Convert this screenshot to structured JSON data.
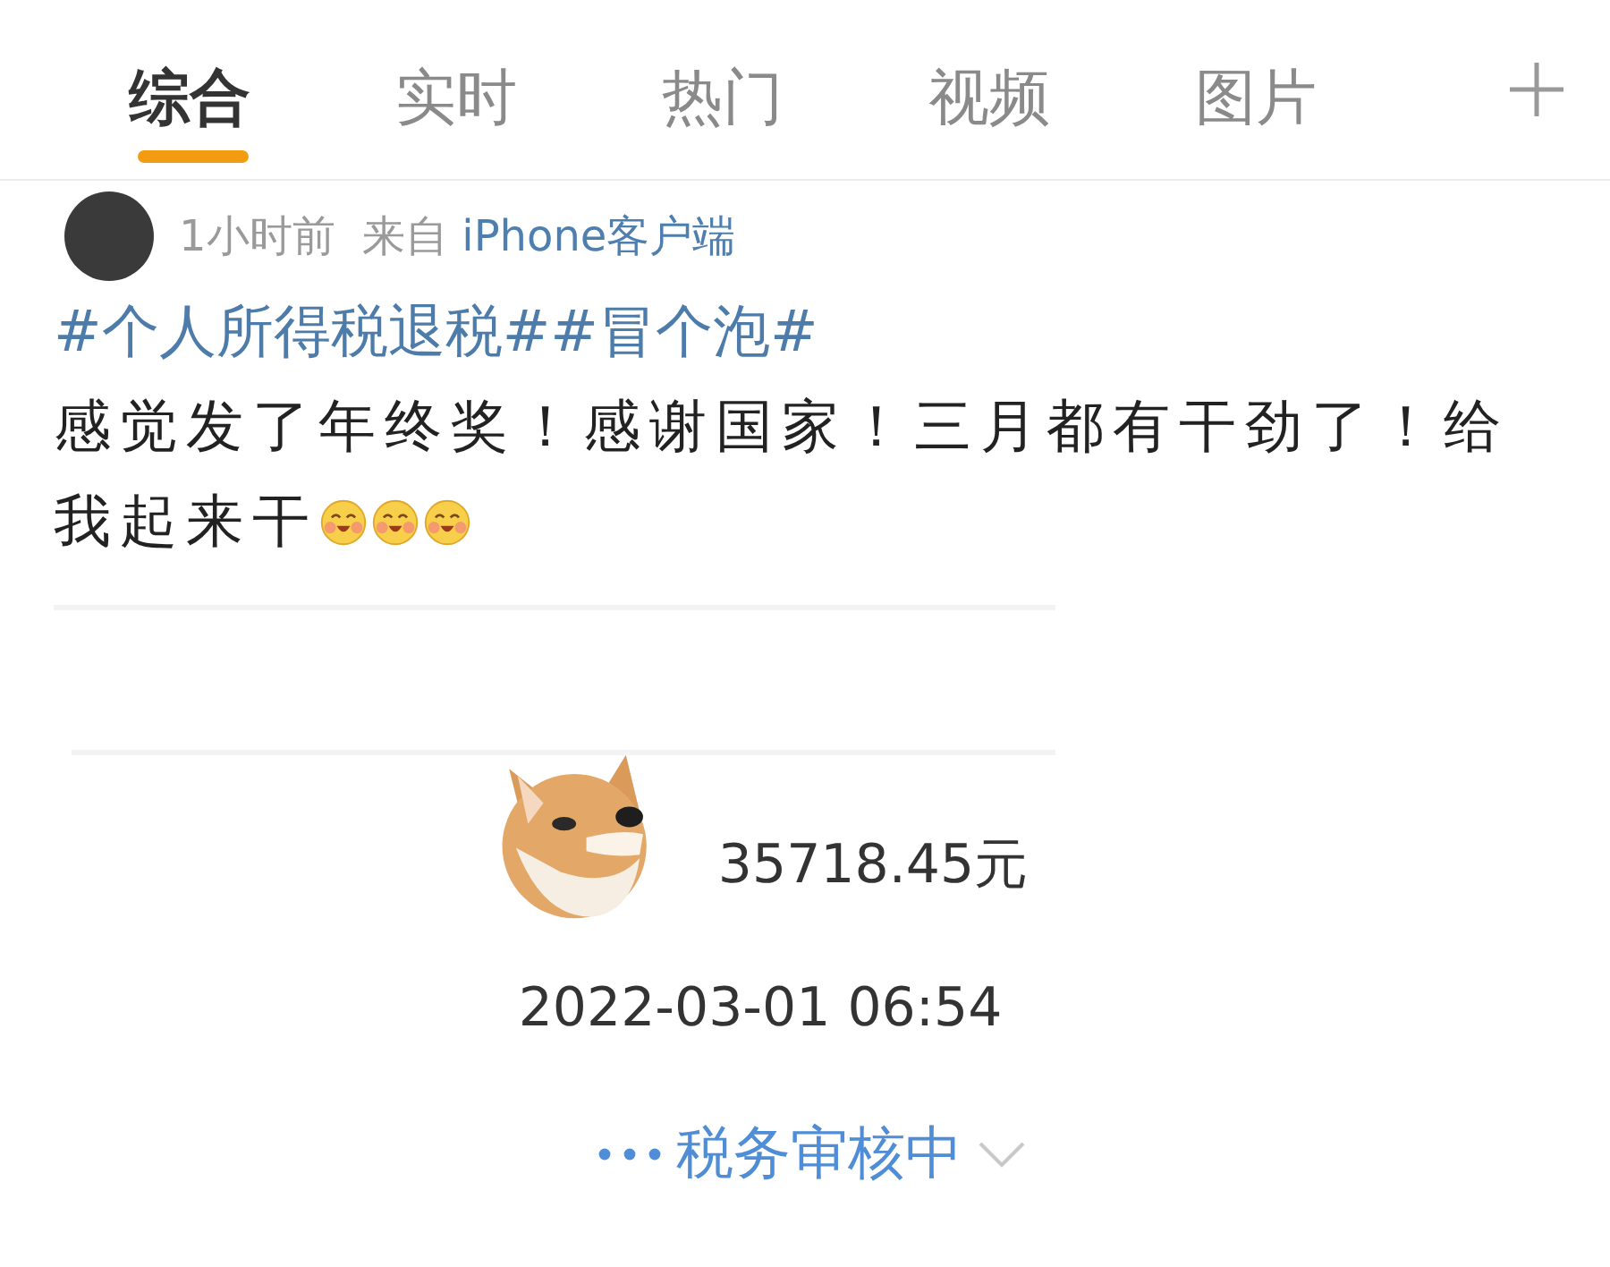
{
  "tabs": [
    {
      "label": "综合",
      "selected": true
    },
    {
      "label": "实时",
      "selected": false
    },
    {
      "label": "热门",
      "selected": false
    },
    {
      "label": "视频",
      "selected": false
    },
    {
      "label": "图片",
      "selected": false
    }
  ],
  "post": {
    "time": "1小时前",
    "source_prefix": "来自",
    "source": "iPhone客户端",
    "hashtags": "#个人所得税退税##冒个泡#",
    "text": "感觉发了年终奖！感谢国家！三月都有干劲了！给我起来干"
  },
  "card": {
    "amount": "35718.45元",
    "date": "2022-03-01 06:54",
    "status": "税务审核中"
  }
}
